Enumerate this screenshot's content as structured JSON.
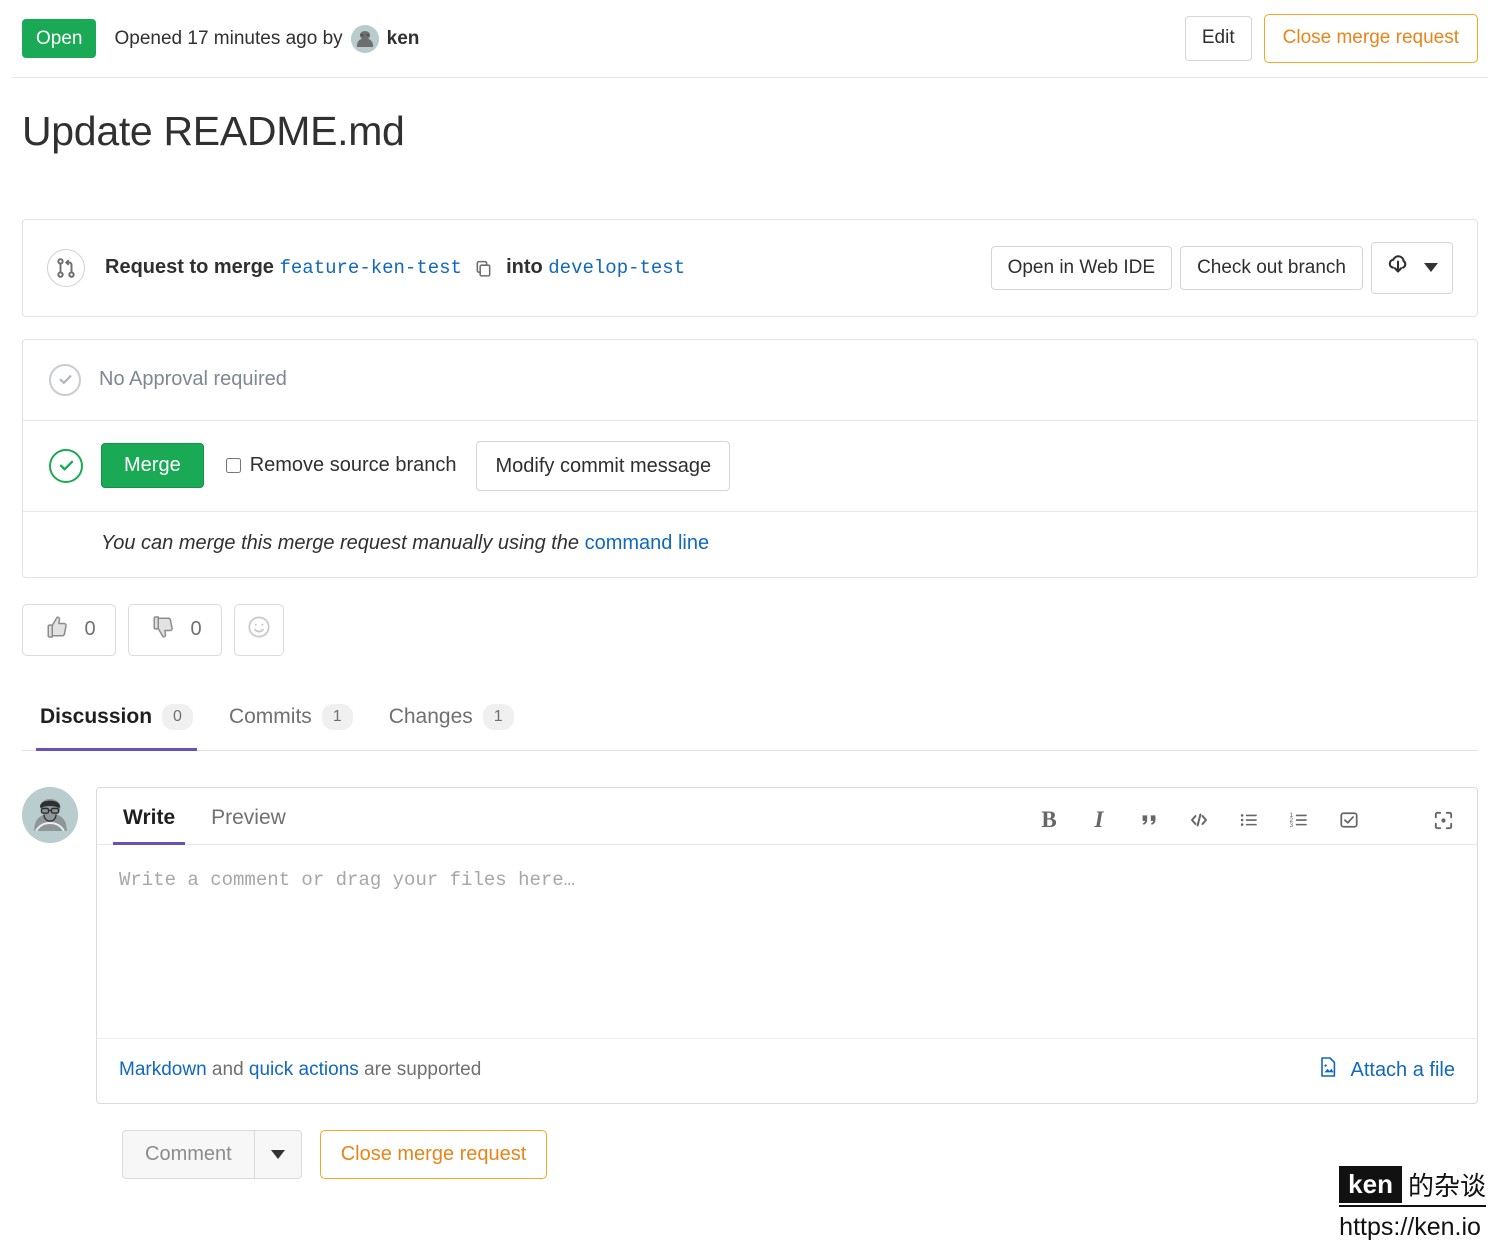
{
  "status": {
    "badge": "Open",
    "opened_text": "Opened 17 minutes ago by",
    "author": "ken",
    "edit_label": "Edit",
    "close_label": "Close merge request"
  },
  "title": "Update README.md",
  "merge_widget": {
    "prefix": "Request to merge",
    "source_branch": "feature-ken-test",
    "into": "into",
    "target_branch": "develop-test",
    "web_ide_label": "Open in Web IDE",
    "checkout_label": "Check out branch"
  },
  "approval": {
    "text": "No Approval required",
    "merge_label": "Merge",
    "remove_source_branch_label": "Remove source branch",
    "modify_commit_label": "Modify commit message",
    "manual_prefix": "You can merge this merge request manually using the",
    "manual_link": "command line"
  },
  "reactions": {
    "thumbs_up_count": "0",
    "thumbs_down_count": "0"
  },
  "tabs": [
    {
      "label": "Discussion",
      "count": "0",
      "active": true
    },
    {
      "label": "Commits",
      "count": "1",
      "active": false
    },
    {
      "label": "Changes",
      "count": "1",
      "active": false
    }
  ],
  "comment_form": {
    "write_tab": "Write",
    "preview_tab": "Preview",
    "placeholder": "Write a comment or drag your files here…",
    "value": "",
    "foot_markdown": "Markdown",
    "foot_and": " and ",
    "foot_quick_actions": "quick actions",
    "foot_suffix": " are supported",
    "attach_label": "Attach a file",
    "comment_button": "Comment",
    "close_mr_button": "Close merge request"
  },
  "toolbar_icons": [
    "bold-icon",
    "italic-icon",
    "quote-icon",
    "code-icon",
    "bullet-list-icon",
    "numbered-list-icon",
    "task-list-icon",
    "fullscreen-icon"
  ],
  "watermark": {
    "brand": "ken",
    "brand_cn": "的杂谈",
    "url": "https://ken.io"
  },
  "colors": {
    "open_green": "#1aaa55",
    "orange": "#e8851a",
    "link_blue": "#1068bf",
    "tab_purple": "#6b4fbb"
  }
}
